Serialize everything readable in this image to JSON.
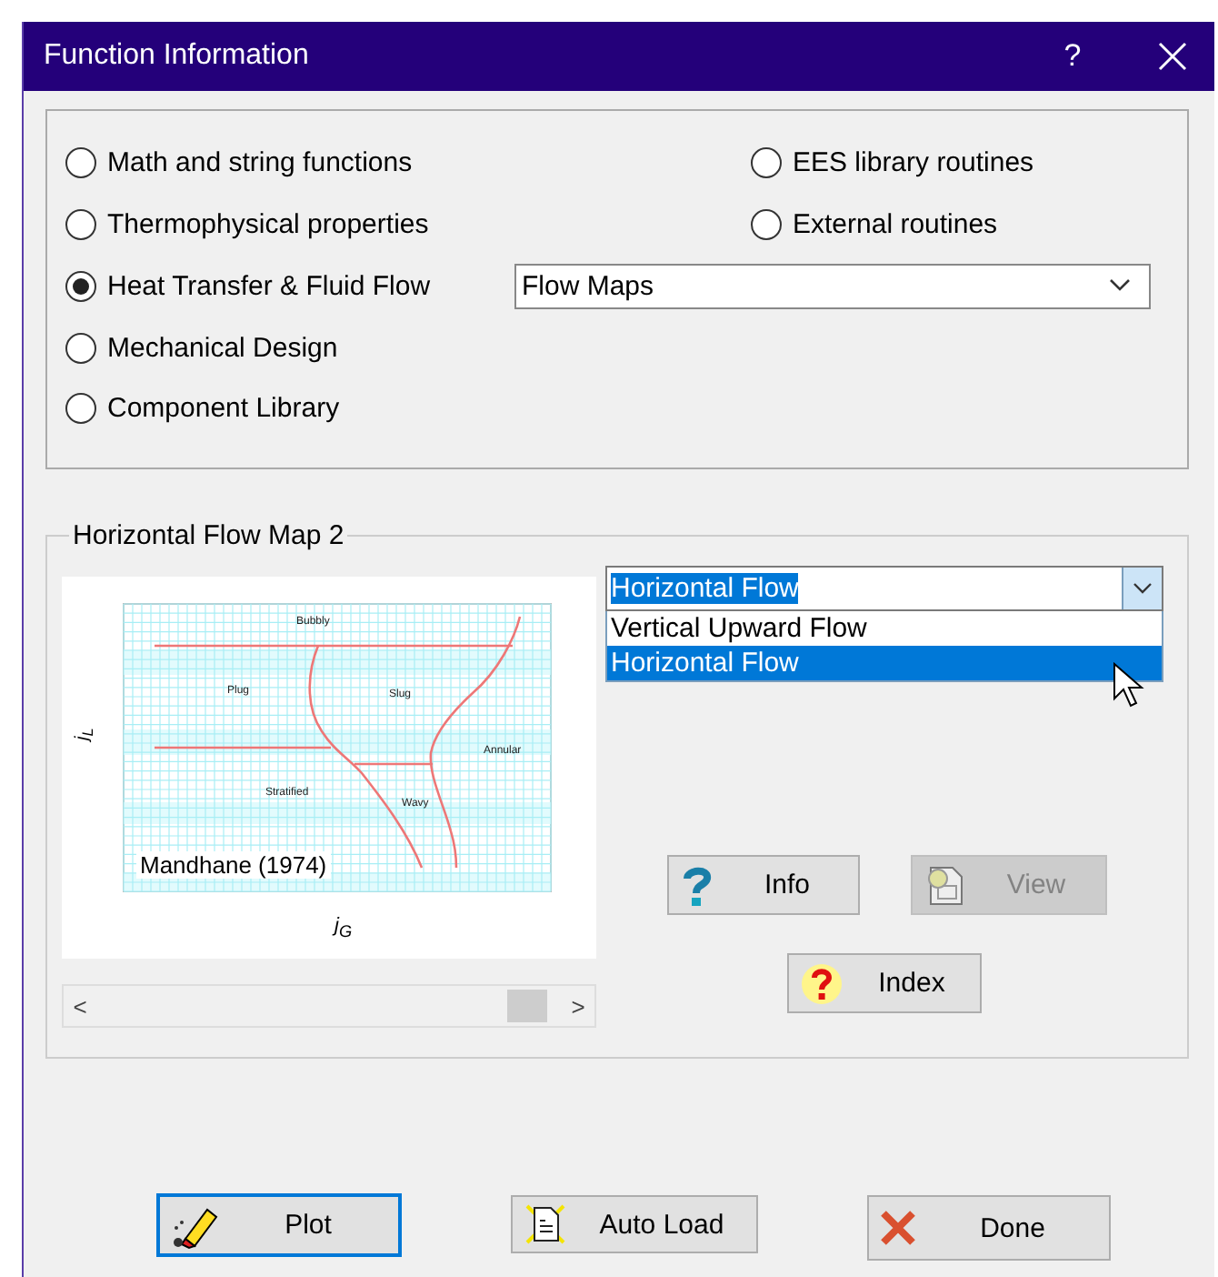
{
  "window": {
    "title": "Function Information",
    "help": "?"
  },
  "categories_left": [
    {
      "label": "Math and string functions",
      "selected": false
    },
    {
      "label": "Thermophysical properties",
      "selected": false
    },
    {
      "label": "Heat Transfer & Fluid Flow",
      "selected": true
    },
    {
      "label": "Mechanical Design",
      "selected": false
    },
    {
      "label": "Component Library",
      "selected": false
    }
  ],
  "categories_right": [
    {
      "label": "EES library routines",
      "selected": false
    },
    {
      "label": "External routines",
      "selected": false
    }
  ],
  "function_group": {
    "value": "Flow Maps"
  },
  "section": {
    "title": "Horizontal Flow Map 2",
    "flow_map": {
      "regions": [
        {
          "label": "Bubbly"
        },
        {
          "label": "Plug"
        },
        {
          "label": "Slug"
        },
        {
          "label": "Annular"
        },
        {
          "label": "Stratified"
        },
        {
          "label": "Wavy"
        }
      ],
      "caption": "Mandhane (1974)",
      "y_axis_label": "j$_{L}$",
      "x_axis_label": "j$_{G}$"
    },
    "scroll_left": "<",
    "scroll_right": ">"
  },
  "combo": {
    "value": "Horizontal Flow",
    "options": [
      {
        "label": "Vertical Upward Flow",
        "selected": false
      },
      {
        "label": "Horizontal Flow",
        "selected": true
      }
    ]
  },
  "buttons": [
    {
      "label": "Info",
      "disabled": false
    },
    {
      "label": "View",
      "disabled": true
    },
    {
      "label": "Index",
      "disabled": false
    }
  ],
  "footer_buttons": [
    {
      "label": "Plot",
      "focused": true
    },
    {
      "label": "Auto Load",
      "focused": false
    },
    {
      "label": "Done",
      "focused": false
    }
  ]
}
